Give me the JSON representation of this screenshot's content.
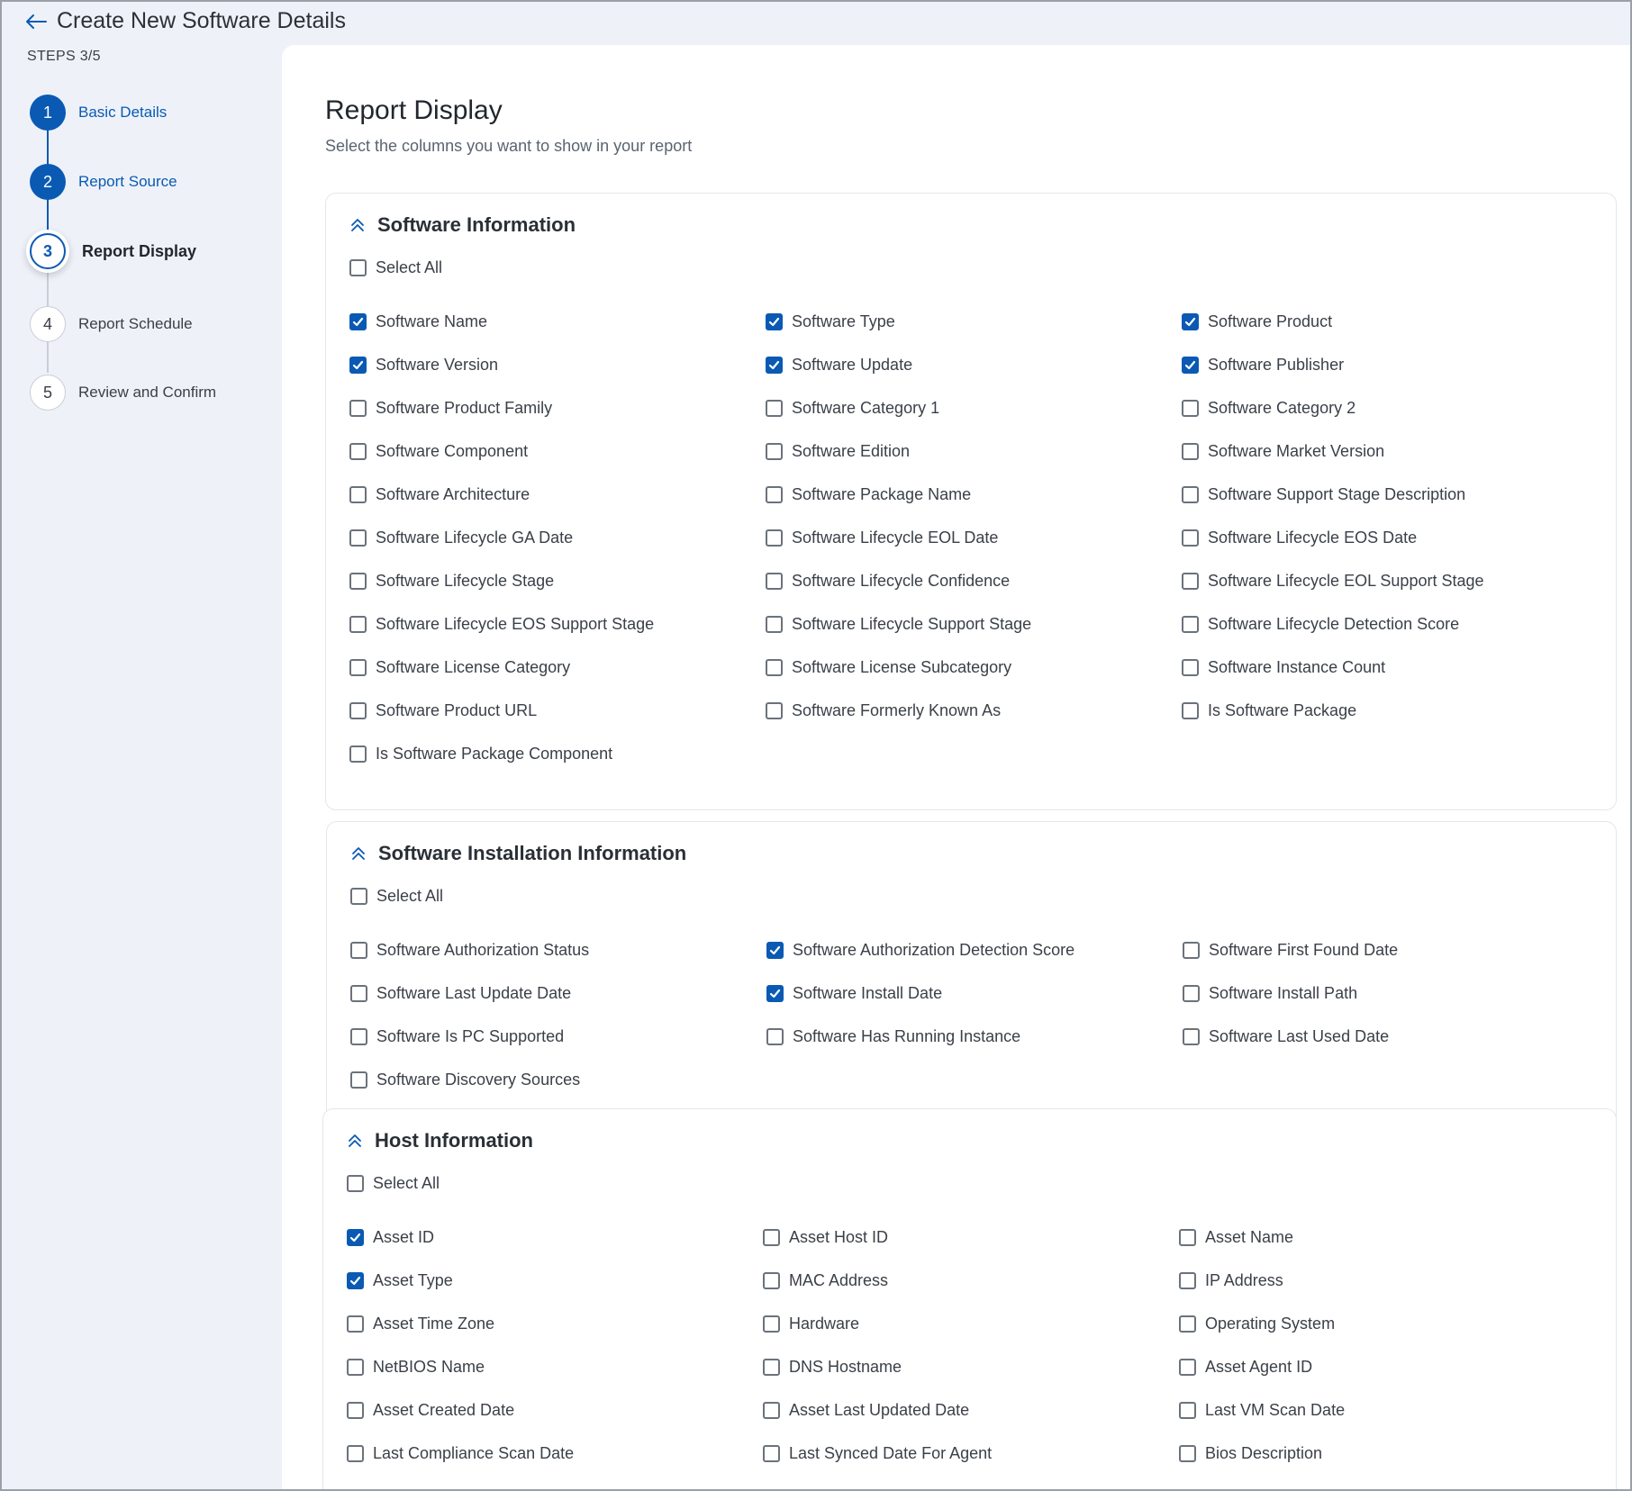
{
  "header": {
    "title": "Create New Software Details"
  },
  "sidebar": {
    "steps_count": "STEPS 3/5",
    "steps": [
      {
        "number": "1",
        "label": "Basic Details",
        "state": "done"
      },
      {
        "number": "2",
        "label": "Report Source",
        "state": "done"
      },
      {
        "number": "3",
        "label": "Report Display",
        "state": "current"
      },
      {
        "number": "4",
        "label": "Report Schedule",
        "state": "todo"
      },
      {
        "number": "5",
        "label": "Review and Confirm",
        "state": "todo"
      }
    ]
  },
  "main": {
    "title": "Report Display",
    "subtitle": "Select the columns you want to show in your report",
    "sections": [
      {
        "title": "Software Information",
        "select_all": {
          "label": "Select All",
          "checked": false
        },
        "items": [
          {
            "label": "Software Name",
            "checked": true
          },
          {
            "label": "Software Type",
            "checked": true
          },
          {
            "label": "Software Product",
            "checked": true
          },
          {
            "label": "Software Version",
            "checked": true
          },
          {
            "label": "Software Update",
            "checked": true
          },
          {
            "label": "Software Publisher",
            "checked": true
          },
          {
            "label": "Software Product Family",
            "checked": false
          },
          {
            "label": "Software Category 1",
            "checked": false
          },
          {
            "label": "Software Category 2",
            "checked": false
          },
          {
            "label": "Software Component",
            "checked": false
          },
          {
            "label": "Software Edition",
            "checked": false
          },
          {
            "label": "Software Market Version",
            "checked": false
          },
          {
            "label": "Software Architecture",
            "checked": false
          },
          {
            "label": "Software Package Name",
            "checked": false
          },
          {
            "label": "Software Support Stage Description",
            "checked": false
          },
          {
            "label": "Software Lifecycle GA Date",
            "checked": false
          },
          {
            "label": "Software Lifecycle EOL Date",
            "checked": false
          },
          {
            "label": "Software Lifecycle EOS Date",
            "checked": false
          },
          {
            "label": "Software Lifecycle Stage",
            "checked": false
          },
          {
            "label": "Software Lifecycle Confidence",
            "checked": false
          },
          {
            "label": "Software Lifecycle EOL Support Stage",
            "checked": false
          },
          {
            "label": "Software Lifecycle EOS Support Stage",
            "checked": false
          },
          {
            "label": "Software Lifecycle Support Stage",
            "checked": false
          },
          {
            "label": "Software Lifecycle Detection Score",
            "checked": false
          },
          {
            "label": "Software License Category",
            "checked": false
          },
          {
            "label": "Software License Subcategory",
            "checked": false
          },
          {
            "label": "Software Instance Count",
            "checked": false
          },
          {
            "label": "Software Product URL",
            "checked": false
          },
          {
            "label": "Software Formerly Known As",
            "checked": false
          },
          {
            "label": "Is Software Package",
            "checked": false
          },
          {
            "label": "Is Software Package Component",
            "checked": false
          }
        ]
      },
      {
        "title": "Software Installation Information",
        "select_all": {
          "label": "Select All",
          "checked": false
        },
        "items": [
          {
            "label": "Software Authorization Status",
            "checked": false
          },
          {
            "label": "Software Authorization Detection Score",
            "checked": true
          },
          {
            "label": "Software First Found Date",
            "checked": false
          },
          {
            "label": "Software Last Update Date",
            "checked": false
          },
          {
            "label": "Software Install Date",
            "checked": true
          },
          {
            "label": "Software Install Path",
            "checked": false
          },
          {
            "label": "Software Is PC Supported",
            "checked": false
          },
          {
            "label": "Software Has Running Instance",
            "checked": false
          },
          {
            "label": "Software Last Used Date",
            "checked": false
          },
          {
            "label": "Software Discovery Sources",
            "checked": false
          }
        ]
      },
      {
        "title": "Host Information",
        "select_all": {
          "label": "Select All",
          "checked": false
        },
        "items": [
          {
            "label": "Asset ID",
            "checked": true
          },
          {
            "label": "Asset Host ID",
            "checked": false
          },
          {
            "label": "Asset Name",
            "checked": false
          },
          {
            "label": "Asset Type",
            "checked": true
          },
          {
            "label": "MAC Address",
            "checked": false
          },
          {
            "label": "IP Address",
            "checked": false
          },
          {
            "label": "Asset Time Zone",
            "checked": false
          },
          {
            "label": "Hardware",
            "checked": false
          },
          {
            "label": "Operating System",
            "checked": false
          },
          {
            "label": "NetBIOS Name",
            "checked": false
          },
          {
            "label": "DNS Hostname",
            "checked": false
          },
          {
            "label": "Asset Agent ID",
            "checked": false
          },
          {
            "label": "Asset Created Date",
            "checked": false
          },
          {
            "label": "Asset Last Updated Date",
            "checked": false
          },
          {
            "label": "Last VM Scan Date",
            "checked": false
          },
          {
            "label": "Last Compliance Scan Date",
            "checked": false
          },
          {
            "label": "Last Synced Date For Agent",
            "checked": false
          },
          {
            "label": "Bios Description",
            "checked": false
          }
        ]
      }
    ]
  },
  "colors": {
    "accent": "#0a5ab4",
    "background": "#eef2f8"
  },
  "icons": {
    "back": "arrow-left-icon",
    "collapse": "double-chevron-up-icon",
    "check": "checkmark-icon"
  }
}
